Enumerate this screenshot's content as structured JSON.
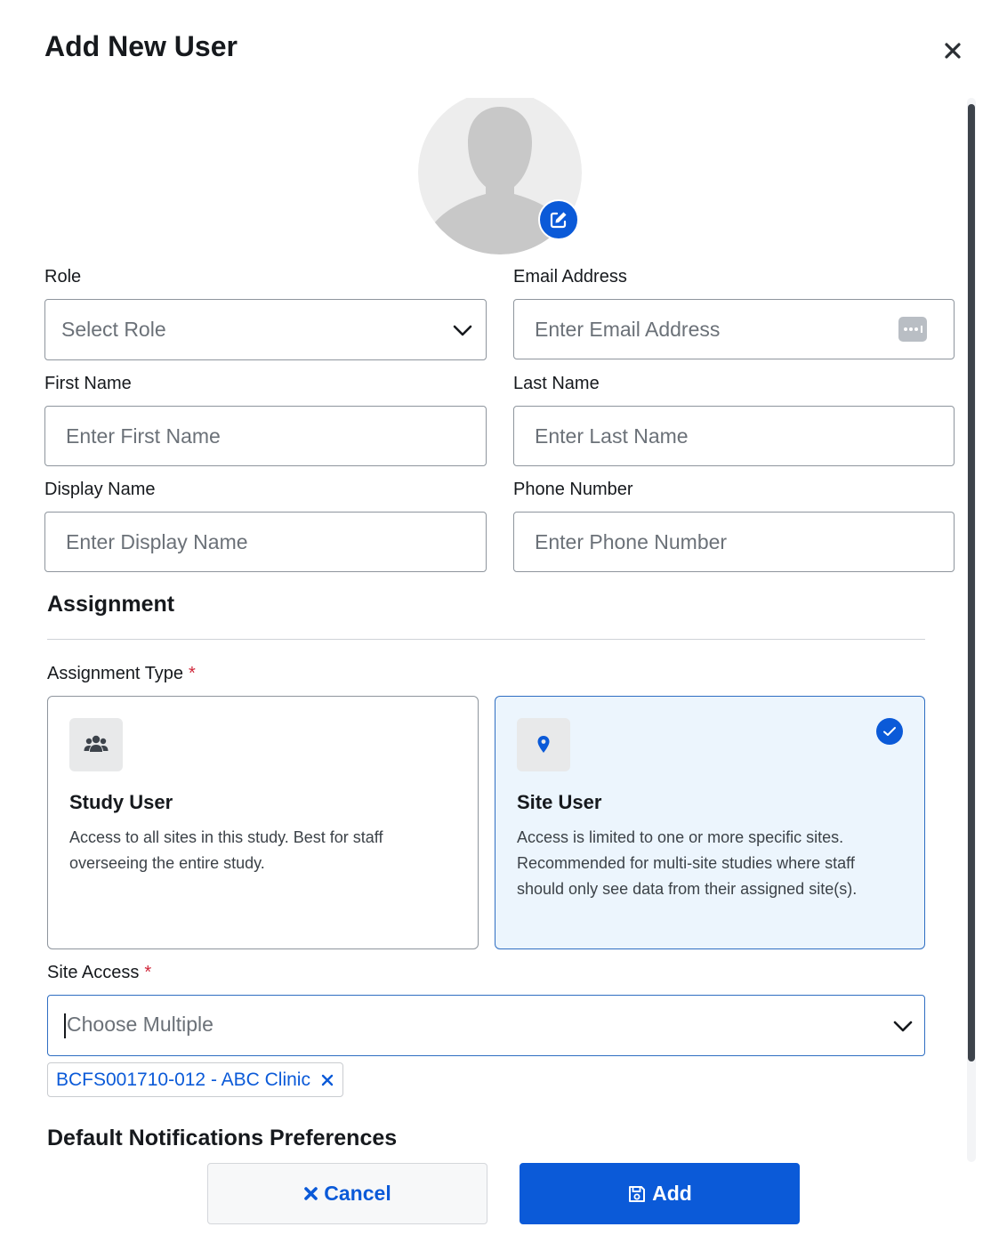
{
  "modal": {
    "title": "Add New User"
  },
  "avatar": {
    "edit_icon": "pencil-square-icon"
  },
  "fields": {
    "role": {
      "label": "Role",
      "placeholder": "Select Role"
    },
    "email": {
      "label": "Email Address",
      "placeholder": "Enter Email Address"
    },
    "first_name": {
      "label": "First Name",
      "placeholder": "Enter First Name"
    },
    "last_name": {
      "label": "Last Name",
      "placeholder": "Enter Last Name"
    },
    "display_name": {
      "label": "Display Name",
      "placeholder": "Enter Display Name"
    },
    "phone": {
      "label": "Phone Number",
      "placeholder": "Enter Phone Number"
    }
  },
  "assignment": {
    "section_title": "Assignment",
    "type_label": "Assignment Type",
    "required_mark": "*",
    "options": [
      {
        "title": "Study User",
        "description": "Access to all sites in this study. Best for staff overseeing the entire study.",
        "icon": "users-icon",
        "selected": false
      },
      {
        "title": "Site User",
        "description": "Access is limited to one or more specific sites. Recommended for multi-site studies where staff should only see data from their assigned site(s).",
        "icon": "map-pin-icon",
        "selected": true
      }
    ]
  },
  "site_access": {
    "label": "Site Access",
    "required_mark": "*",
    "placeholder": "Choose Multiple",
    "selected": [
      {
        "label": "BCFS001710-012 - ABC Clinic"
      }
    ]
  },
  "notifications": {
    "section_title": "Default Notifications Preferences"
  },
  "footer": {
    "cancel_label": "Cancel",
    "add_label": "Add"
  },
  "colors": {
    "primary": "#0b5ad8",
    "selected_bg": "#ecf5fd",
    "required": "#d0273a"
  }
}
